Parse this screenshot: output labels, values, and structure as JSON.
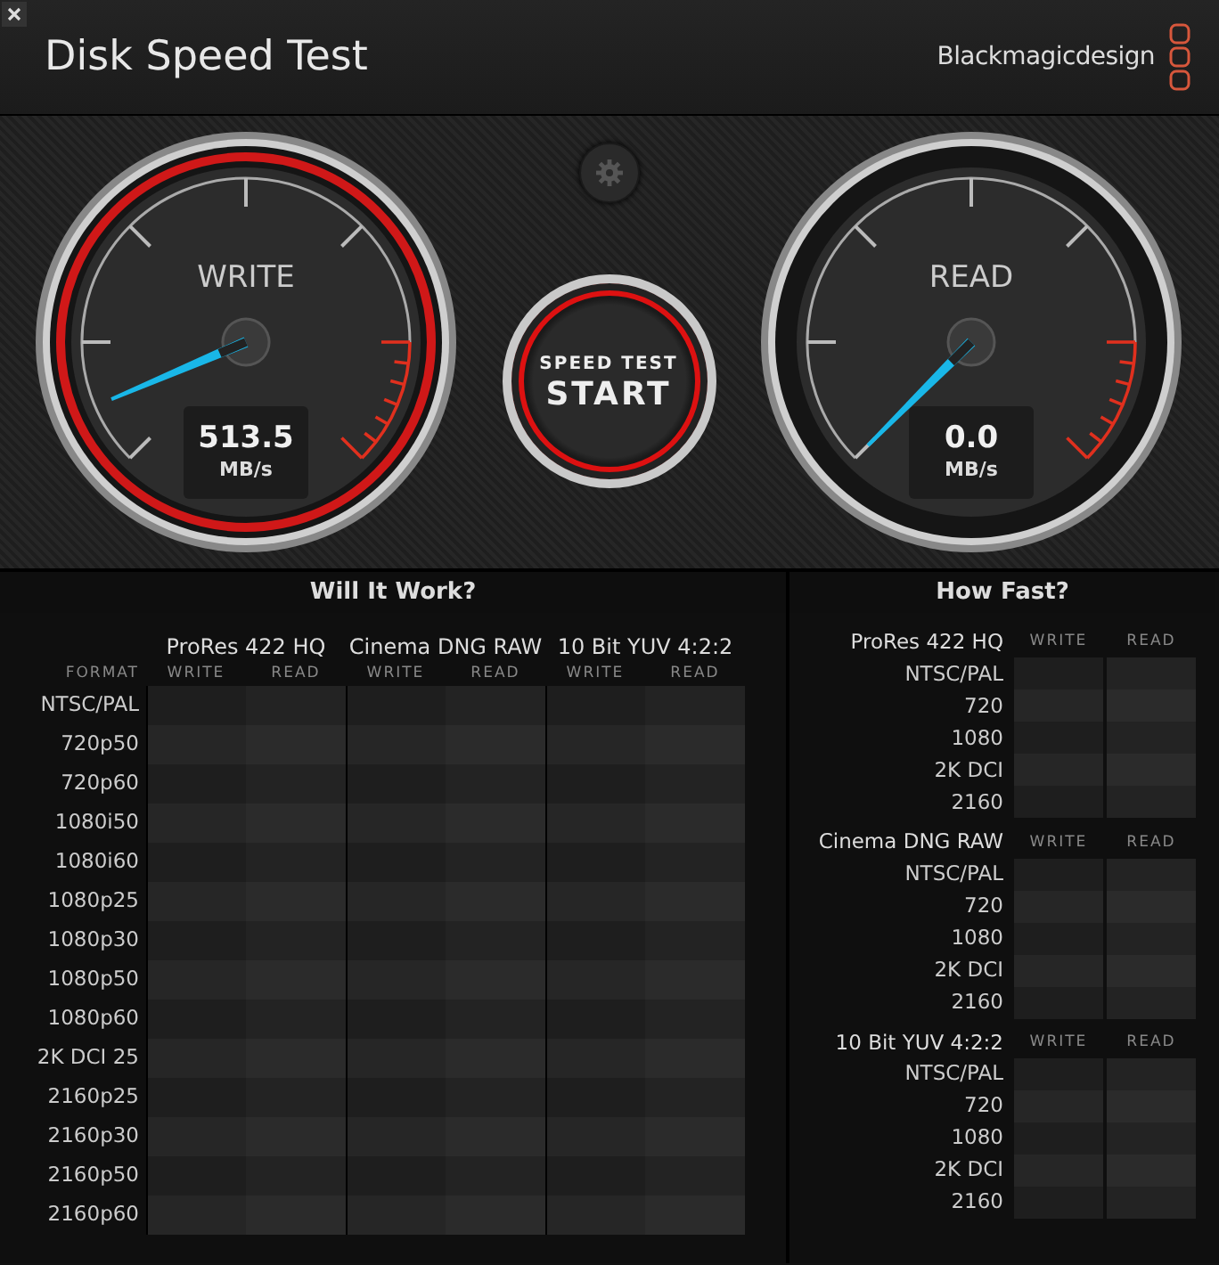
{
  "window": {
    "title": "Disk Speed Test",
    "brand": "Blackmagicdesign"
  },
  "gauges": [
    {
      "label": "WRITE",
      "value": "513.5",
      "unit": "MB/s",
      "active": true
    },
    {
      "label": "READ",
      "value": "0.0",
      "unit": "MB/s",
      "active": false
    }
  ],
  "start_button": {
    "caption": "SPEED TEST",
    "label": "START"
  },
  "will_it_work": {
    "title": "Will It Work?",
    "format_header": "FORMAT",
    "codecs": [
      {
        "name": "ProRes 422 HQ",
        "columns": [
          "WRITE",
          "READ"
        ]
      },
      {
        "name": "Cinema DNG RAW",
        "columns": [
          "WRITE",
          "READ"
        ]
      },
      {
        "name": "10 Bit YUV 4:2:2",
        "columns": [
          "WRITE",
          "READ"
        ]
      }
    ],
    "rows": [
      "NTSC/PAL",
      "720p50",
      "720p60",
      "1080i50",
      "1080i60",
      "1080p25",
      "1080p30",
      "1080p50",
      "1080p60",
      "2K DCI 25",
      "2160p25",
      "2160p30",
      "2160p50",
      "2160p60"
    ]
  },
  "how_fast": {
    "title": "How Fast?",
    "groups": [
      {
        "name": "ProRes 422 HQ",
        "columns": [
          "WRITE",
          "READ"
        ],
        "rows": [
          "NTSC/PAL",
          "720",
          "1080",
          "2K DCI",
          "2160"
        ]
      },
      {
        "name": "Cinema DNG RAW",
        "columns": [
          "WRITE",
          "READ"
        ],
        "rows": [
          "NTSC/PAL",
          "720",
          "1080",
          "2K DCI",
          "2160"
        ]
      },
      {
        "name": "10 Bit YUV 4:2:2",
        "columns": [
          "WRITE",
          "READ"
        ],
        "rows": [
          "NTSC/PAL",
          "720",
          "1080",
          "2K DCI",
          "2160"
        ]
      }
    ]
  }
}
